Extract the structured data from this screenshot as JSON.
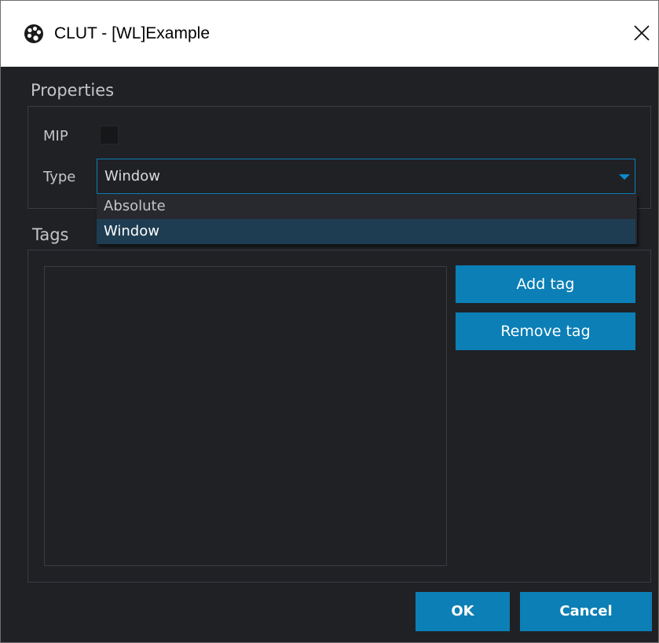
{
  "window": {
    "title": "CLUT - [WL]Example",
    "icon": "palette-icon",
    "close_symbol": "✕"
  },
  "properties": {
    "heading": "Properties",
    "mip_label": "MIP",
    "mip_checked": false,
    "type_label": "Type",
    "type_value": "Window",
    "type_options": [
      {
        "label": "Absolute",
        "selected": false
      },
      {
        "label": "Window",
        "selected": true
      }
    ]
  },
  "tags": {
    "heading": "Tags",
    "items": [],
    "add_label": "Add tag",
    "remove_label": "Remove tag"
  },
  "footer": {
    "ok_label": "OK",
    "cancel_label": "Cancel"
  },
  "colors": {
    "background": "#202125",
    "accent": "#0b7fb6",
    "selected_item": "#1e3d52",
    "text": "#c3c5c9"
  }
}
